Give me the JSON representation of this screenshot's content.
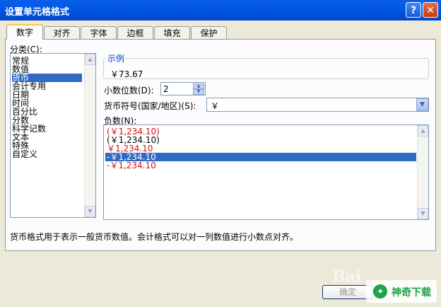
{
  "window": {
    "title": "设置单元格格式",
    "help_glyph": "?",
    "close_glyph": "✕"
  },
  "tabs": [
    "数字",
    "对齐",
    "字体",
    "边框",
    "填充",
    "保护"
  ],
  "category": {
    "label": "分类(C):",
    "items": [
      "常规",
      "数值",
      "货币",
      "会计专用",
      "日期",
      "时间",
      "百分比",
      "分数",
      "科学记数",
      "文本",
      "特殊",
      "自定义"
    ],
    "selected_index": 2
  },
  "sample": {
    "label": "示例",
    "value": "￥73.67"
  },
  "decimal": {
    "label": "小数位数(D):",
    "value": "2"
  },
  "currency": {
    "label": "货币符号(国家/地区)(S):",
    "value": "￥"
  },
  "negative": {
    "label": "负数(N):",
    "items": [
      {
        "text": "(￥1,234.10)",
        "red": true
      },
      {
        "text": "(￥1,234.10)",
        "red": false
      },
      {
        "text": "￥1,234.10",
        "red": true
      },
      {
        "text": "-￥1,234.10",
        "red": false
      },
      {
        "text": "-￥1,234.10",
        "red": true
      }
    ],
    "selected_index": 3
  },
  "description": "货币格式用于表示一般货币数值。会计格式可以对一列数值进行小数点对齐。",
  "buttons": {
    "ok": "确定"
  },
  "watermark": {
    "brand": "神奇下载",
    "faint": "Bai"
  },
  "colors": {
    "title_bar": "#0058E6",
    "selection": "#316AC5",
    "negative_red": "#D01010",
    "dialog_bg": "#ECE9D8"
  },
  "icons": {
    "spin_up": "up-arrow-icon",
    "spin_down": "down-arrow-icon",
    "dropdown": "chevron-down-icon"
  }
}
